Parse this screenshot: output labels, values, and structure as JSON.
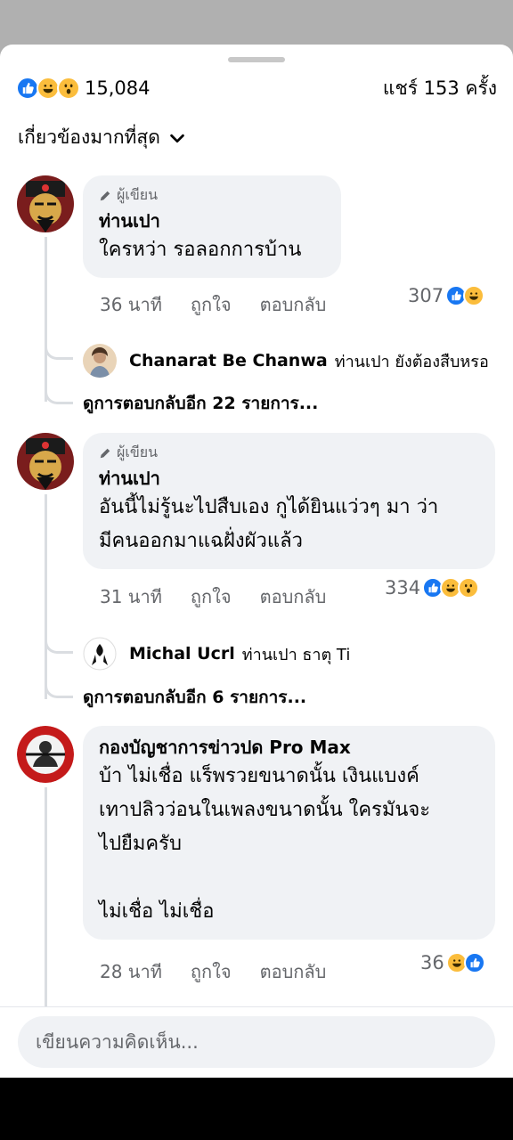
{
  "summary": {
    "reaction_count": "15,084",
    "shares": "แชร์ 153 ครั้ง"
  },
  "sort": {
    "label": "เกี่ยวข้องมากที่สุด"
  },
  "comments": [
    {
      "badge": "ผู้เขียน",
      "name": "ท่านเปา",
      "text": "ใครหว่า รอลอกการบ้าน",
      "time": "36 นาที",
      "like": "ถูกใจ",
      "reply": "ตอบกลับ",
      "reactions": "307",
      "reply_preview": {
        "name": "Chanarat Be Chanwa",
        "text": "ท่านเปา ยังต้องสืบหรอ"
      },
      "more_replies": "ดูการตอบกลับอีก 22 รายการ..."
    },
    {
      "badge": "ผู้เขียน",
      "name": "ท่านเปา",
      "text": "อันนี้ไม่รู้นะไปสืบเอง กูได้ยินแว่วๆ มา ว่า\nมีคนออกมาแฉฝั่งผัวแล้ว",
      "time": "31 นาที",
      "like": "ถูกใจ",
      "reply": "ตอบกลับ",
      "reactions": "334",
      "reply_preview": {
        "name": "Michal Ucrl",
        "text": "ท่านเปา ธาตุ Ti"
      },
      "more_replies": "ดูการตอบกลับอีก 6 รายการ..."
    },
    {
      "name": "กองบัญชาการข่าวปด Pro Max",
      "text": "บ้า ไม่เชื่อ แร็พรวยขนาดนั้น เงินแบงค์\nเทาปลิวว่อนในเพลงขนาดนั้น ใครมันจะ\nไปยืมครับ\n\nไม่เชื่อ ไม่เชื่อ",
      "time": "28 นาที",
      "like": "ถูกใจ",
      "reply": "ตอบกลับ",
      "reactions": "36"
    }
  ],
  "composer": {
    "placeholder": "เขียนความคิดเห็น..."
  },
  "icons": {
    "like": "like-reaction-icon",
    "haha": "haha-reaction-icon",
    "wow": "wow-reaction-icon",
    "author": "pencil-icon",
    "sort": "chevron-down-icon"
  },
  "colors": {
    "like_blue": "#1877f2",
    "emoji_yellow": "#fbbd3c",
    "bubble": "#f0f2f5"
  }
}
